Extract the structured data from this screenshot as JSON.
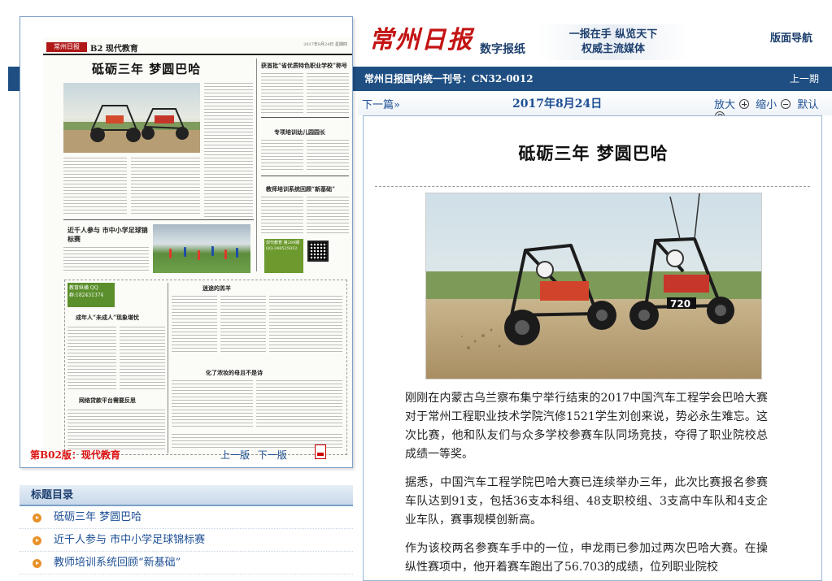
{
  "masthead": {
    "logo_text": "常州日报",
    "subtitle": "数字报纸",
    "slogan_line1": "一报在手 纵览天下",
    "slogan_line2": "权威主流媒体",
    "nav_guide": "版面导航"
  },
  "issue_bar": {
    "cn_number": "常州日报国内统一刊号：CN32-0012",
    "prev_issue": "上一期"
  },
  "toolbar": {
    "next_issue": "下一篇",
    "date": "2017年8月24日",
    "zoom_in": "放大",
    "zoom_out": "缩小",
    "reset": "默认"
  },
  "page_thumbnail": {
    "logo": "常州日报",
    "section": "现代教育",
    "page_code": "B2",
    "date_line": "2017年8月24日 星期四",
    "headline": "砥砺三年  梦圆巴哈",
    "side_headline_1": "获首批“省优质特色职业学校”称号",
    "side_headline_2": "专项培训幼儿园园长",
    "side_headline_3": "教师培训系统回顾“新基础”",
    "mid_headline": "近千人参与 市中小学足球锦标赛",
    "lower_headline_1": "成年人“未成人”现象堪忧",
    "lower_headline_2": "迷途的羔羊",
    "lower_headline_3": "化了浓妆的母且不是诗",
    "lower_headline_4": "网络贷款平台需要反思",
    "ad_box": "现代教育 第289期 QQ:348525032",
    "green_box": "教育纵横 QQ群:182431374"
  },
  "page_label": "第B02版：现代教育",
  "page_nav": {
    "prev": "上一版",
    "next": "下一版"
  },
  "toc": {
    "title": "标题目录",
    "items": [
      "砥砺三年 梦圆巴哈",
      "近千人参与 市中小学足球锦标赛",
      "教师培训系统回顾“新基础”"
    ]
  },
  "article": {
    "title": "砥砺三年  梦圆巴哈",
    "paragraphs": [
      "刚刚在内蒙古乌兰察布集宁举行结束的2017中国汽车工程学会巴哈大赛对于常州工程职业技术学院汽修1521学生刘创来说，势必永生难忘。这次比赛，他和队友们与众多学校参赛车队同场竞技，夺得了职业院校总成绩一等奖。",
      "据悉，中国汽车工程学院巴哈大赛已连续举办三年，此次比赛报名参赛车队达到91支，包括36支本科组、48支职校组、3支高中车队和4支企业车队，赛事规模创新高。",
      "作为该校两名参赛车手中的一位，申龙雨已参加过两次巴哈大赛。在操纵性赛项中，他开着赛车跑出了56.703的成绩，位列职业院校"
    ],
    "photo_car_number": "720"
  },
  "colors": {
    "brand_blue": "#1f4f82",
    "brand_red": "#c41414",
    "link_blue": "#1d4f94",
    "bullet_orange": "#e8912a"
  }
}
